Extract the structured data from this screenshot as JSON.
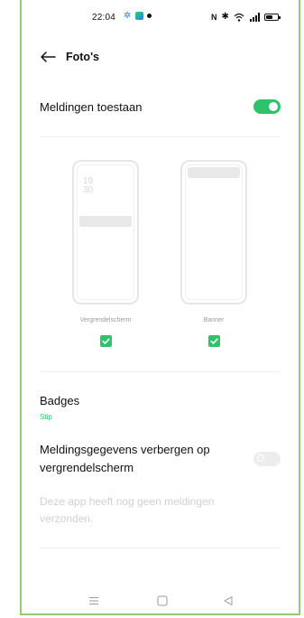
{
  "status_bar": {
    "time": "22:04",
    "icons": [
      "settings-gear-icon",
      "app-notification-icon",
      "location-dot-icon",
      "nfc-icon",
      "bluetooth-icon",
      "wifi-icon",
      "signal-icon",
      "battery-icon"
    ]
  },
  "header": {
    "back_icon": "arrow-left-icon",
    "title": "Foto's"
  },
  "allow_notifications": {
    "label": "Meldingen toestaan",
    "enabled": true
  },
  "styles": [
    {
      "caption": "Vergrendelscherm",
      "clock_hour": "19",
      "clock_minute": "30",
      "checked": true
    },
    {
      "caption": "Banner",
      "checked": true
    }
  ],
  "badges": {
    "label": "Badges",
    "value": "Stip"
  },
  "hide_details": {
    "label": "Meldingsgegevens verbergen op vergrendelscherm",
    "enabled": false
  },
  "note": "Deze app heeft nog geen meldingen verzonden.",
  "nav_bar": [
    "menu-icon",
    "home-square-icon",
    "back-triangle-icon"
  ],
  "colors": {
    "accent": "#2ec26a",
    "frame_border": "#8fce74",
    "disabled_text": "#d0d0d0"
  }
}
